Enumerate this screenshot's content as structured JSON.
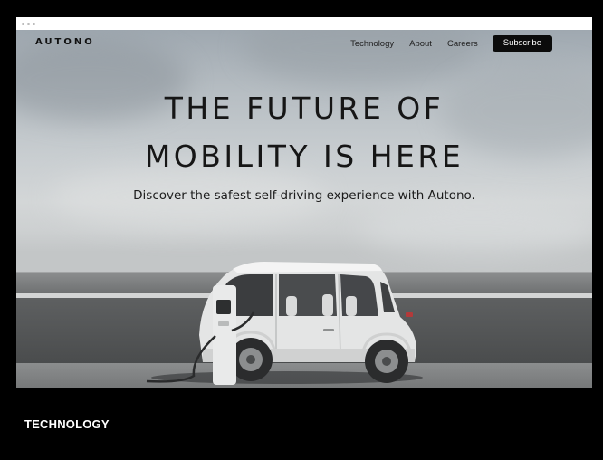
{
  "site": {
    "logo": "AUTONO",
    "nav": {
      "items": [
        {
          "label": "Technology"
        },
        {
          "label": "About"
        },
        {
          "label": "Careers"
        }
      ],
      "subscribe_label": "Subscribe"
    }
  },
  "hero": {
    "headline_line1": "THE FUTURE OF",
    "headline_line2": "MOBILITY IS HERE",
    "subheadline": "Discover the safest self-driving experience with Autono.",
    "image": "autonomous-electric-car-charging"
  },
  "caption": "TECHNOLOGY",
  "colors": {
    "background": "#000000",
    "button": "#0b0b0b",
    "text": "#161616"
  }
}
